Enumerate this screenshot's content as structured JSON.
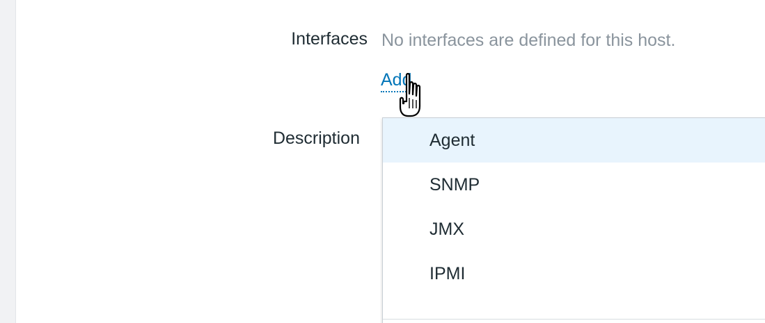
{
  "form": {
    "interfaces_label": "Interfaces",
    "interfaces_empty": "No interfaces are defined for this host.",
    "add_link": "Add",
    "description_label": "Description"
  },
  "dropdown": {
    "items": [
      {
        "label": "Agent",
        "active": true
      },
      {
        "label": "SNMP",
        "active": false
      },
      {
        "label": "JMX",
        "active": false
      },
      {
        "label": "IPMI",
        "active": false
      }
    ]
  },
  "icons": {
    "cursor": "hand-pointer-icon"
  },
  "colors": {
    "link": "#0275b8",
    "muted_text": "#8a949d",
    "primary_text": "#1f2c33",
    "hover_background": "#e8f4fd",
    "rail_background": "#f1f2f4"
  }
}
